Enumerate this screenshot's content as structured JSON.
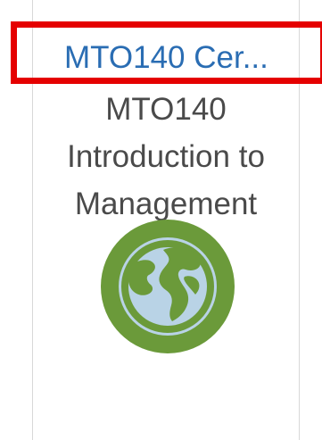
{
  "course_card": {
    "link_label": "MTO140 Cer...",
    "description_lines": [
      "MTO140",
      "Introduction to",
      "Management"
    ],
    "icon": "globe-icon"
  },
  "colors": {
    "link": "#2a6db3",
    "text": "#4a4a4a",
    "highlight": "#e50000",
    "globe_ring": "#6b9a3a",
    "globe_ocean": "#b9d3e6",
    "globe_land": "#6b9a3a"
  }
}
